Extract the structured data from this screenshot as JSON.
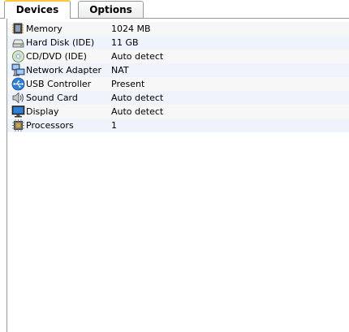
{
  "tabs": [
    {
      "label": "Devices",
      "active": true
    },
    {
      "label": "Options",
      "active": false
    }
  ],
  "devices": [
    {
      "name": "Memory",
      "value": "1024 MB",
      "icon": "memory-chip-icon"
    },
    {
      "name": "Hard Disk (IDE)",
      "value": "11 GB",
      "icon": "hard-disk-icon"
    },
    {
      "name": "CD/DVD (IDE)",
      "value": "Auto detect",
      "icon": "cd-dvd-icon"
    },
    {
      "name": "Network Adapter",
      "value": "NAT",
      "icon": "network-adapter-icon"
    },
    {
      "name": "USB Controller",
      "value": "Present",
      "icon": "usb-icon"
    },
    {
      "name": "Sound Card",
      "value": "Auto detect",
      "icon": "speaker-icon"
    },
    {
      "name": "Display",
      "value": "Auto detect",
      "icon": "monitor-icon"
    },
    {
      "name": "Processors",
      "value": "1",
      "icon": "processor-chip-icon"
    }
  ],
  "colors": {
    "tab_highlight": "#ffc83c",
    "tab_border": "#919b9c"
  }
}
